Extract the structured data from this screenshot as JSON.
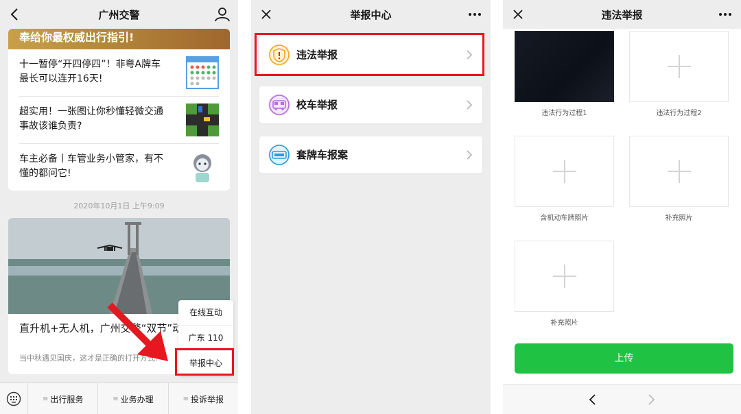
{
  "panel1": {
    "title": "广州交警",
    "banner": "奉给你最权威出行指引!",
    "news": [
      {
        "text": "十一暂停“开四停四”！非粤A牌车最长可以连开16天!"
      },
      {
        "text": "超实用！一张图让你秒懂轻微交通事故该谁负责?"
      },
      {
        "text": "车主必备丨车管业务小管家，有不懂的都问它!"
      }
    ],
    "timestamp": "2020年10月1日 上午9:09",
    "article_title": "直升机+无人机，广州交警“双节”动作!",
    "article_sub": "当中秋遇见国庆，这才是正确的打开方式!",
    "popup": [
      "在线互动",
      "广东 110",
      "举报中心"
    ],
    "menu": [
      "出行服务",
      "业务办理",
      "投诉举报"
    ]
  },
  "panel2": {
    "title": "举报中心",
    "items": [
      {
        "label": "违法举报",
        "color": "#f2a81d"
      },
      {
        "label": "校车举报",
        "color": "#b56ce0"
      },
      {
        "label": "套牌车报案",
        "color": "#2a9be0"
      }
    ]
  },
  "panel3": {
    "title": "违法举报",
    "slots": [
      {
        "label": "违法行为过程1"
      },
      {
        "label": "违法行为过程2"
      },
      {
        "label": "含机动车牌照片"
      },
      {
        "label": "补充照片"
      },
      {
        "label": "补充照片"
      }
    ],
    "upload": "上传"
  },
  "colors": {
    "highlight": "#e8161f",
    "upload": "#1fc243"
  }
}
